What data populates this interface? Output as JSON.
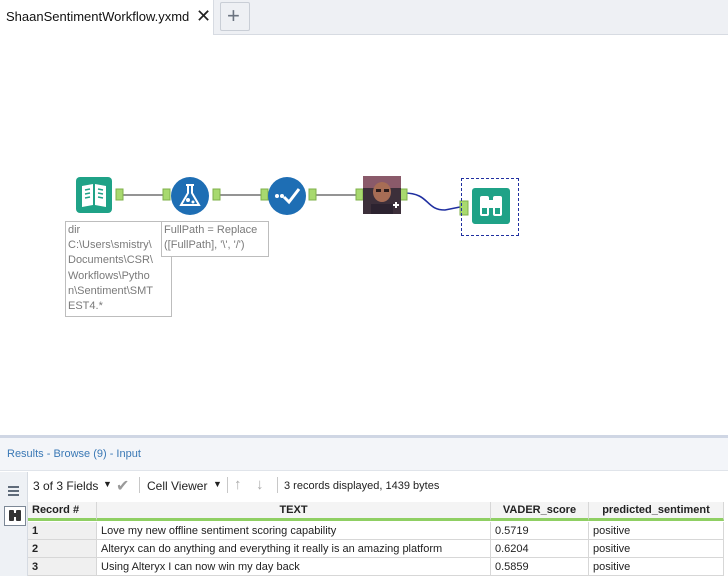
{
  "tab": {
    "title": "ShaanSentimentWorkflow.yxmd",
    "close_icon": "close-icon",
    "new_tab_icon": "plus-icon"
  },
  "canvas": {
    "tools": [
      {
        "name": "input-data-tool",
        "icon": "book-icon",
        "color": "#1fa287"
      },
      {
        "name": "formula-tool",
        "icon": "flask-icon",
        "color": "#1e6eb4"
      },
      {
        "name": "select-tool",
        "icon": "checkmark-icon",
        "color": "#1e6eb4"
      },
      {
        "name": "python-tool",
        "icon": "avatar-photo"
      },
      {
        "name": "browse-tool",
        "icon": "binoculars-icon",
        "color": "#1fa287"
      }
    ],
    "annotations": {
      "input_lines": [
        "dir",
        "C:\\Users\\smistry\\",
        "Documents\\CSR\\",
        "Workflows\\Pytho",
        "n\\Sentiment\\SMT",
        "EST4.*"
      ],
      "formula_lines": [
        "FullPath = Replace",
        "([FullPath], '\\', '/')"
      ]
    }
  },
  "results": {
    "title": "Results - Browse (9) - Input",
    "fields_label": "3 of 3 Fields",
    "viewer_label": "Cell Viewer",
    "status": "3 records displayed, 1439 bytes",
    "columns": [
      "Record #",
      "TEXT",
      "VADER_score",
      "predicted_sentiment"
    ],
    "rows": [
      [
        "1",
        "Love my new offline sentiment scoring capability",
        "0.5719",
        "positive"
      ],
      [
        "2",
        "Alteryx can do anything and everything it really is an amazing platform",
        "0.6204",
        "positive"
      ],
      [
        "3",
        "Using Alteryx I can now win my day back",
        "0.5859",
        "positive"
      ]
    ]
  }
}
